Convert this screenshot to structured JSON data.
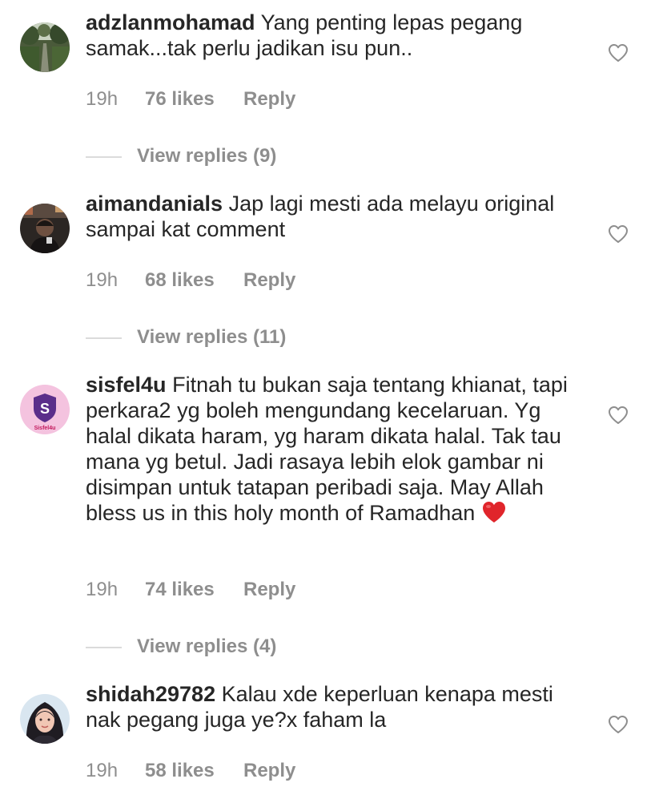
{
  "colors": {
    "text": "#262626",
    "meta": "#8e8e8e",
    "divider": "#dbdbdb",
    "emoji_heart": "#e0252b"
  },
  "comments": [
    {
      "username": "adzlanmohamad",
      "text": "Yang penting lepas pegang samak...tak perlu jadikan isu pun..",
      "time": "19h",
      "likes": "76 likes",
      "reply": "Reply",
      "view_replies": "View replies (9)",
      "avatar": "garden-path-photo"
    },
    {
      "username": "aimandanials",
      "text": "Jap lagi mesti ada melayu original sampai kat comment",
      "time": "19h",
      "likes": "68 likes",
      "reply": "Reply",
      "view_replies": "View replies (11)",
      "avatar": "man-photo"
    },
    {
      "username": "sisfel4u",
      "text": "Fitnah tu bukan saja tentang khianat, tapi perkara2 yg boleh mengundang kecelaruan. Yg halal dikata haram, yg haram dikata halal. Tak tau mana yg betul. Jadi rasaya lebih elok gambar ni disimpan untuk tatapan peribadi saja. May Allah bless us in this holy month of Ramadhan",
      "emoji": "red-heart-emoji",
      "time": "19h",
      "likes": "74 likes",
      "reply": "Reply",
      "view_replies": "View replies (4)",
      "avatar": "sisfel4u-logo",
      "avatar_text": "Sisfel4u",
      "avatar_letter": "S"
    },
    {
      "username": "shidah29782",
      "text": "Kalau xde keperluan kenapa mesti nak pegang juga ye?x faham la",
      "time": "19h",
      "likes": "58 likes",
      "reply": "Reply",
      "avatar": "woman-hijab-photo"
    }
  ],
  "icons": {
    "like": "heart-outline-icon"
  }
}
